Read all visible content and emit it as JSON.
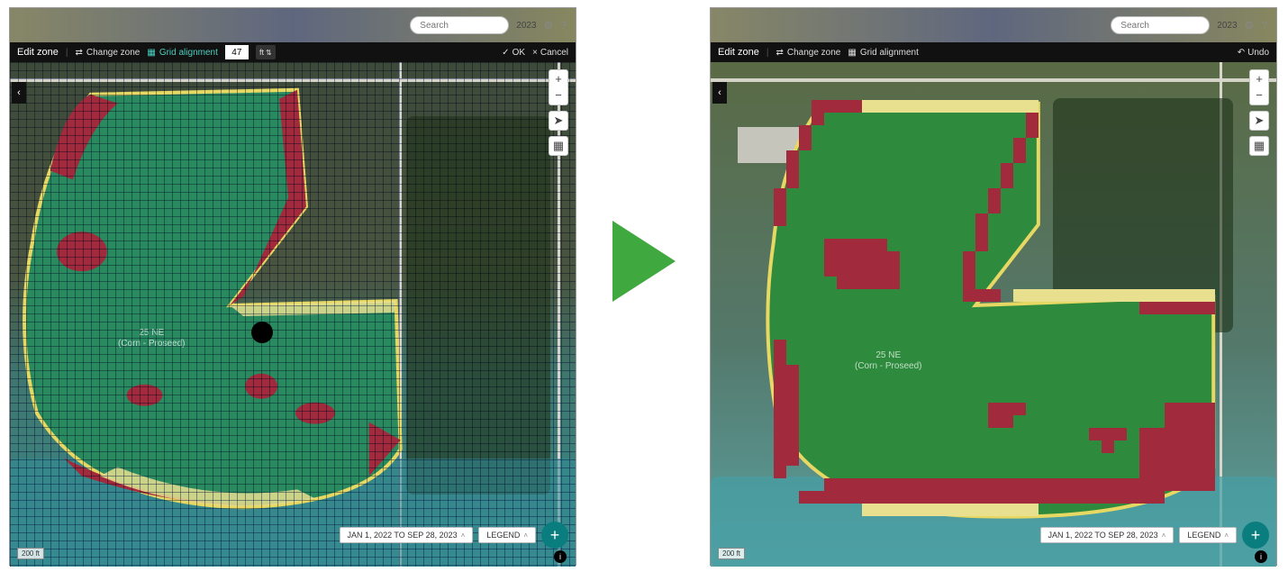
{
  "header": {
    "search_placeholder": "Search",
    "year": "2023",
    "settings_icon": "⚙",
    "help_icon": "?"
  },
  "toolbar": {
    "title": "Edit zone",
    "change_zone": "Change zone",
    "grid_alignment": "Grid alignment",
    "grid_value": "47",
    "grid_unit": "ft",
    "ok": "OK",
    "cancel": "Cancel",
    "undo": "Undo"
  },
  "field": {
    "name": "25 NE",
    "crop": "(Corn - Proseed)",
    "zone_colors": {
      "primary": "#2a8a5f",
      "low": "#a12a3d",
      "mid": "#e8df8f",
      "outline": "#e6d862"
    },
    "zone_colors_right": {
      "primary": "#2e8b3d"
    }
  },
  "footer": {
    "date_range": "JAN 1, 2022 TO SEP 28, 2023",
    "legend": "LEGEND",
    "scale": "200 ft",
    "add": "+"
  },
  "map_controls": {
    "zoom_in": "+",
    "zoom_out": "−",
    "locate": "➤",
    "layers": "▦"
  },
  "icons": {
    "back": "‹",
    "check": "✓",
    "close": "×",
    "undo": "↶",
    "swap": "⇄",
    "grid": "▦",
    "chevron_up": "˄",
    "stepper": "⇅",
    "info": "i"
  }
}
